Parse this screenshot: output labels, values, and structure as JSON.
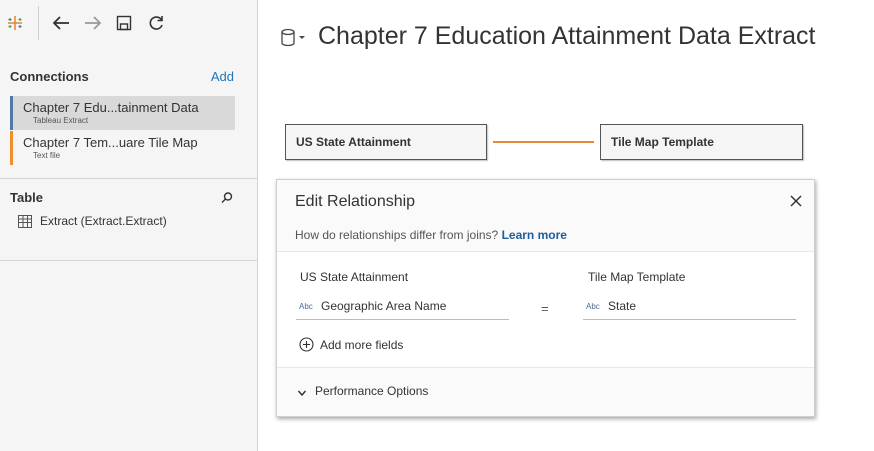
{
  "toolbar": {
    "icons": [
      "tableau-logo-icon",
      "back-arrow-icon",
      "forward-arrow-icon",
      "save-icon",
      "refresh-icon"
    ]
  },
  "connections": {
    "title": "Connections",
    "add_label": "Add",
    "items": [
      {
        "name": "Chapter 7 Edu...tainment Data",
        "type": "Tableau Extract",
        "selected": true,
        "color": "#4e79a7"
      },
      {
        "name": "Chapter 7 Tem...uare Tile Map",
        "type": "Text file",
        "selected": false,
        "color": "#f28e2b"
      }
    ]
  },
  "table_panel": {
    "title": "Table",
    "items": [
      {
        "label": "Extract (Extract.Extract)"
      }
    ]
  },
  "datasource": {
    "title": "Chapter 7 Education Attainment Data Extract"
  },
  "canvas": {
    "left_table": "US State Attainment",
    "right_table": "Tile Map Template",
    "relationship_color": "#e8883a"
  },
  "edit_relationship": {
    "title": "Edit Relationship",
    "question": "How do relationships differ from joins?",
    "learn_more": "Learn more",
    "left_table_label": "US State Attainment",
    "right_table_label": "Tile Map Template",
    "left_field_type": "Abc",
    "left_field": "Geographic Area Name",
    "operator": "=",
    "right_field_type": "Abc",
    "right_field": "State",
    "add_more_fields": "Add more fields",
    "performance_options": "Performance Options"
  }
}
